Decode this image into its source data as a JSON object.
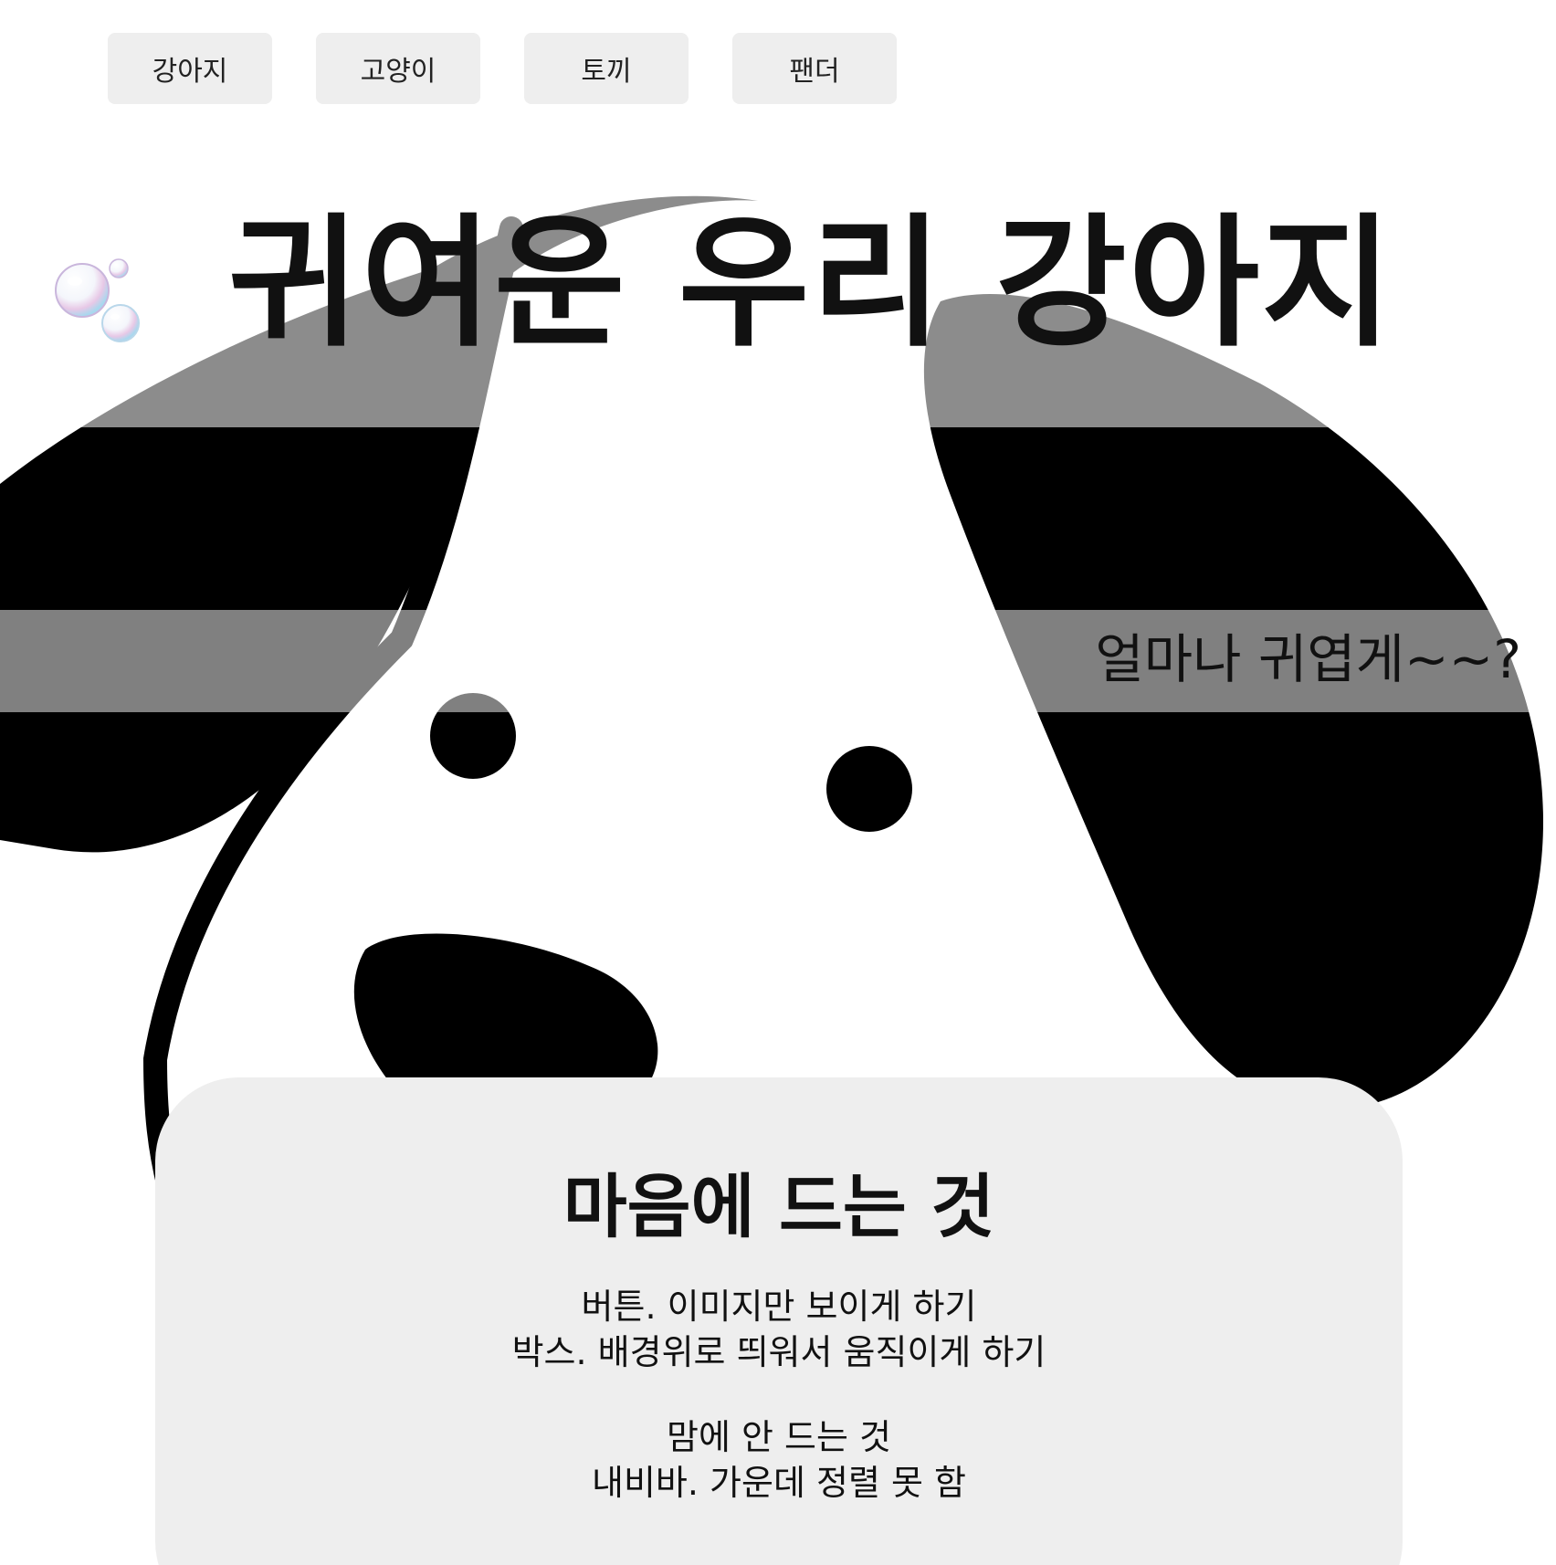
{
  "nav": {
    "items": [
      {
        "label": "강아지"
      },
      {
        "label": "고양이"
      },
      {
        "label": "토끼"
      },
      {
        "label": "팬더"
      }
    ]
  },
  "hero": {
    "title": "귀여운 우리 강아지",
    "subtitle": "얼마나 귀엽게~~?",
    "bubble_icon": "bubbles-icon"
  },
  "card": {
    "heading": "마음에 드는 것",
    "likes": [
      "버튼. 이미지만 보이게 하기",
      "박스. 배경위로 띄워서 움직이게 하기"
    ],
    "dislikes_title": "맘에 안 드는 것",
    "dislikes": [
      "내비바. 가운데 정렬 못 함"
    ]
  },
  "colors": {
    "background": "#ffffff",
    "button_bg": "#eeeeee",
    "card_bg": "#eeeeee",
    "dog_fill": "#000000",
    "text": "#111111"
  }
}
